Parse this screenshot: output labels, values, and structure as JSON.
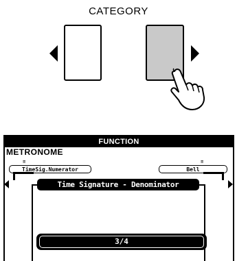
{
  "category": {
    "title": "CATEGORY"
  },
  "function_display": {
    "header": "FUNCTION",
    "mode_label": "METRONOME",
    "left_item": "TimeSig.Numerator",
    "right_item": "Bell",
    "page_title": "Time Signature - Denominator",
    "value": "3/4"
  },
  "icons": {
    "left_triangle": "triangle-left-icon",
    "right_triangle": "triangle-right-icon",
    "hand": "pressing-hand-icon"
  },
  "colors": {
    "pressed_button": "#c9c9c9",
    "lcd_fill": "#000000"
  }
}
